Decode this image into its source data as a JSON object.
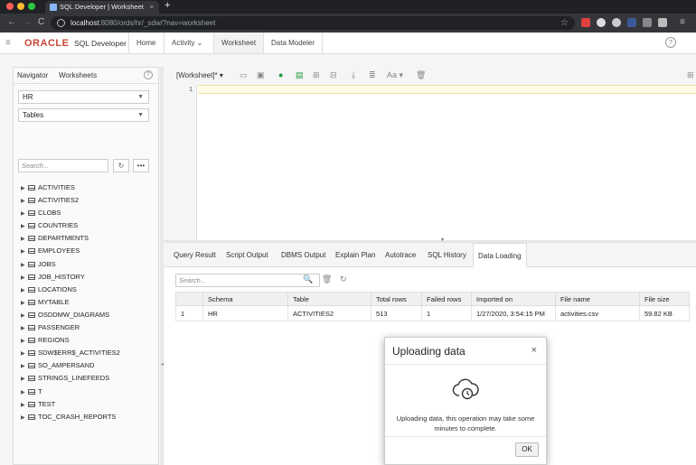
{
  "browser": {
    "tab_title": "SQL Developer | Worksheet",
    "new_tab": "+",
    "url_host": "localhost",
    "url_rest": ":8080/ords/hr/_sdw/?nav=worksheet"
  },
  "app": {
    "logo": "ORACLE",
    "product": "SQL Developer",
    "tabs": [
      "Home",
      "Activity",
      "Worksheet",
      "Data Modeler"
    ],
    "help": "?"
  },
  "navigator": {
    "tabs": [
      "Navigator",
      "Worksheets"
    ],
    "help": "?",
    "schema": "HR",
    "object_type": "Tables",
    "search_placeholder": "Search...",
    "refresh": "↻",
    "more": "•••",
    "tables": [
      "ACTIVITIES",
      "ACTIVITIES2",
      "CLOBS",
      "COUNTRIES",
      "DEPARTMENTS",
      "EMPLOYEES",
      "JOBS",
      "JOB_HISTORY",
      "LOCATIONS",
      "MYTABLE",
      "OSDDMW_DIAGRAMS",
      "PASSENGER",
      "REGIONS",
      "SDW$ERR$_ACTIVITIES2",
      "SO_AMPERSAND",
      "STRINGS_LINEFEEDS",
      "T",
      "TEST",
      "TOC_CRASH_REPORTS"
    ]
  },
  "editor": {
    "worksheet_label": "[Worksheet]*",
    "line_number": "1"
  },
  "results": {
    "tabs": [
      "Query Result",
      "Script Output",
      "DBMS Output",
      "Explain Plan",
      "Autotrace",
      "SQL History",
      "Data Loading"
    ],
    "search_placeholder": "Search...",
    "columns": [
      "",
      "Schema",
      "Table",
      "Total rows",
      "Failed rows",
      "Imported on",
      "File name",
      "File size"
    ],
    "rows": [
      [
        "1",
        "HR",
        "ACTIVITIES2",
        "513",
        "1",
        "1/27/2020, 3:54:15 PM",
        "activities.csv",
        "59.82 KB"
      ]
    ]
  },
  "dialog": {
    "title": "Uploading data",
    "close": "×",
    "message": "Uploading data, this operation may take some minutes to complete.",
    "ok": "OK"
  }
}
